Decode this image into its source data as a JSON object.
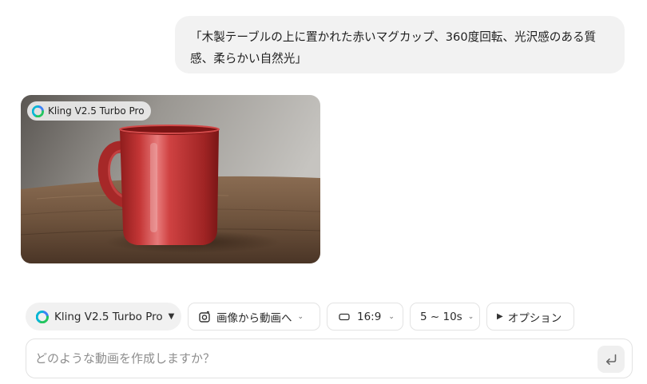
{
  "chat": {
    "user_message": "「木製テーブルの上に置かれた赤いマグカップ、360度回転、光沢感のある質感、柔らかい自然光」"
  },
  "result": {
    "model_tag": "Kling V2.5 Turbo Pro",
    "logo_icon": "kling-logo-icon",
    "image_content": "red-mug-on-wooden-table"
  },
  "toolbar": {
    "model_label": "Kling V2.5 Turbo Pro",
    "mode_label": "画像から動画へ",
    "ratio_label": "16:9",
    "duration_label": "5 ~ 10s",
    "options_label": "オプション",
    "icons": {
      "mode": "image-to-video-icon",
      "ratio": "aspect-ratio-icon",
      "dropdown": "chevron-down-icon",
      "model_dropdown": "caret-down-icon",
      "options": "play-triangle-icon"
    }
  },
  "composer": {
    "placeholder": "どのような動画を作成しますか？",
    "value": "",
    "send_icon": "enter-return-icon"
  },
  "colors": {
    "bubble_bg": "#f2f2f2",
    "mug_red": "#c93a3a",
    "chip_border": "#e3e3e3",
    "logo_green": "#22c55e",
    "logo_blue": "#3b82f6"
  }
}
